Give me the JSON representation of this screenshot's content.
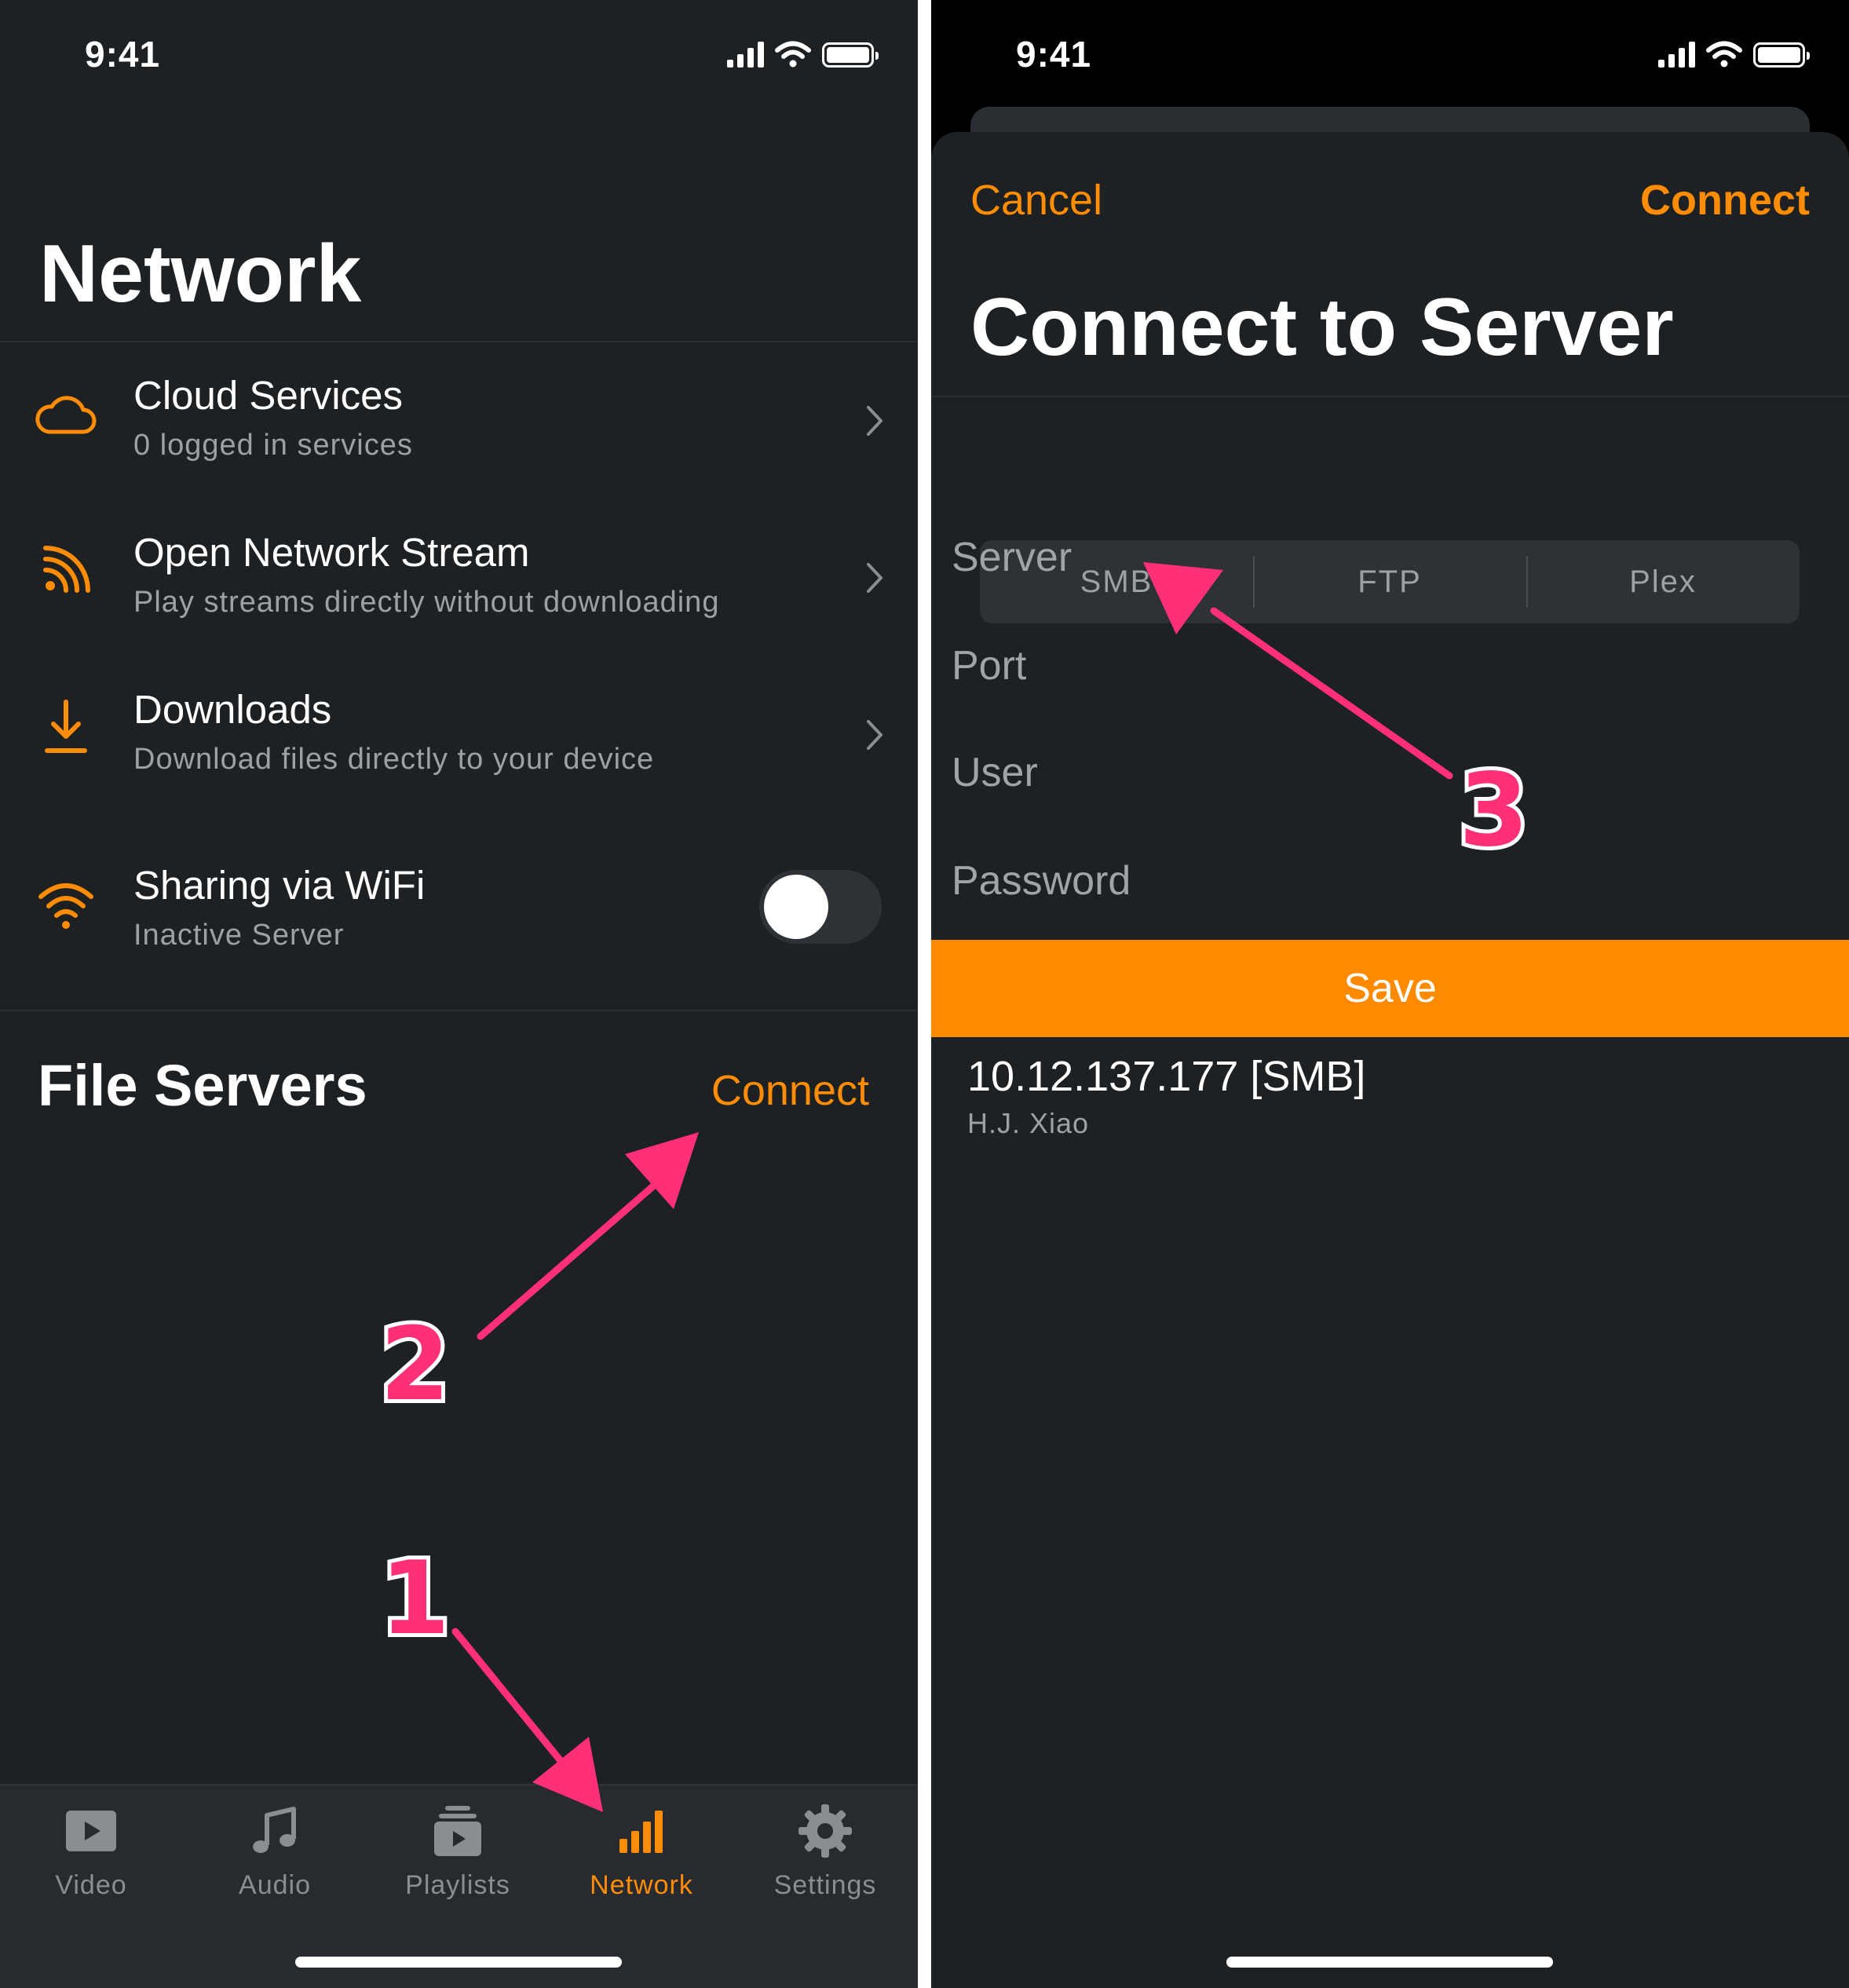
{
  "left_screen": {
    "status_time": "9:41",
    "title": "Network",
    "items": [
      {
        "title": "Cloud Services",
        "subtitle": "0 logged in services",
        "icon": "cloud-icon"
      },
      {
        "title": "Open Network Stream",
        "subtitle": "Play streams directly without downloading",
        "icon": "rss-icon"
      },
      {
        "title": "Downloads",
        "subtitle": "Download files directly to your device",
        "icon": "download-icon"
      },
      {
        "title": "Sharing via WiFi",
        "subtitle": "Inactive Server",
        "icon": "wifi-icon",
        "toggle_on": false
      }
    ],
    "section_title": "File Servers",
    "connect_label": "Connect",
    "tabs": [
      {
        "label": "Video",
        "icon": "video-icon",
        "active": false
      },
      {
        "label": "Audio",
        "icon": "music-note-icon",
        "active": false
      },
      {
        "label": "Playlists",
        "icon": "playlist-icon",
        "active": false
      },
      {
        "label": "Network",
        "icon": "network-bars-icon",
        "active": true
      },
      {
        "label": "Settings",
        "icon": "gear-icon",
        "active": false
      }
    ]
  },
  "right_screen": {
    "status_time": "9:41",
    "cancel_label": "Cancel",
    "connect_label": "Connect",
    "title": "Connect to Server",
    "protocols": [
      "SMB",
      "FTP",
      "Plex"
    ],
    "fields": {
      "server": "Server",
      "port": "Port",
      "user": "User",
      "password": "Password"
    },
    "save_label": "Save",
    "saved_server": {
      "address": "10.12.137.177 [SMB]",
      "name": "H.J. Xiao"
    }
  },
  "annotations": [
    "1",
    "2",
    "3"
  ],
  "colors": {
    "background": "#1e2124",
    "accent": "#ff8c05",
    "save_button": "#ff8a00",
    "annotation": "#ff2f78"
  }
}
